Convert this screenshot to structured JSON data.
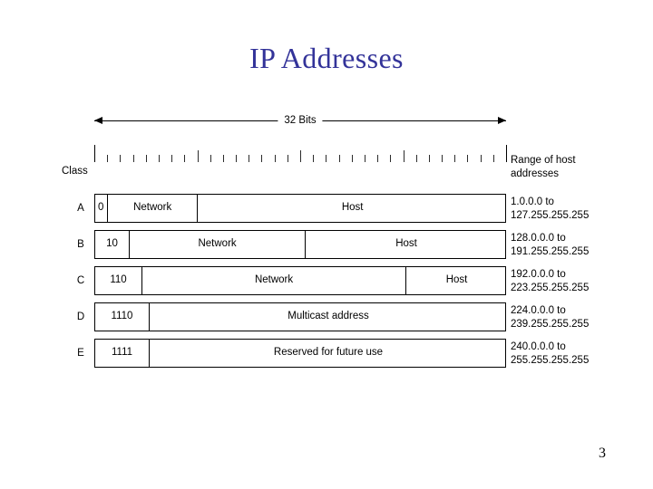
{
  "slide": {
    "title": "IP Addresses",
    "page_number": "3",
    "title_color": "#333399",
    "background_color": "#ffffff"
  },
  "figure": {
    "width_label": "32 Bits",
    "total_bits": 32,
    "class_label": "Class",
    "range_header_line1": "Range of host",
    "range_header_line2": "addresses",
    "rows": [
      {
        "letter": "A",
        "prefix_bits": "0",
        "prefix_bit_count": 1,
        "fields": [
          {
            "label": "Network",
            "bits": 7
          },
          {
            "label": "Host",
            "bits": 24
          }
        ],
        "range_start": "1.0.0.0 to",
        "range_end": "127.255.255.255"
      },
      {
        "letter": "B",
        "prefix_bits": "10",
        "prefix_bit_count": 2,
        "fields": [
          {
            "label": "Network",
            "bits": 14
          },
          {
            "label": "Host",
            "bits": 16
          }
        ],
        "range_start": "128.0.0.0 to",
        "range_end": "191.255.255.255"
      },
      {
        "letter": "C",
        "prefix_bits": "110",
        "prefix_bit_count": 3,
        "fields": [
          {
            "label": "Network",
            "bits": 21
          },
          {
            "label": "Host",
            "bits": 8
          }
        ],
        "range_start": "192.0.0.0 to",
        "range_end": "223.255.255.255"
      },
      {
        "letter": "D",
        "prefix_bits": "1110",
        "prefix_bit_count": 4,
        "fields": [
          {
            "label": "Multicast address",
            "bits": 28
          }
        ],
        "range_start": "224.0.0.0 to",
        "range_end": "239.255.255.255"
      },
      {
        "letter": "E",
        "prefix_bits": "1111",
        "prefix_bit_count": 4,
        "fields": [
          {
            "label": "Reserved for future use",
            "bits": 28
          }
        ],
        "range_start": "240.0.0.0 to",
        "range_end": "255.255.255.255"
      }
    ]
  }
}
